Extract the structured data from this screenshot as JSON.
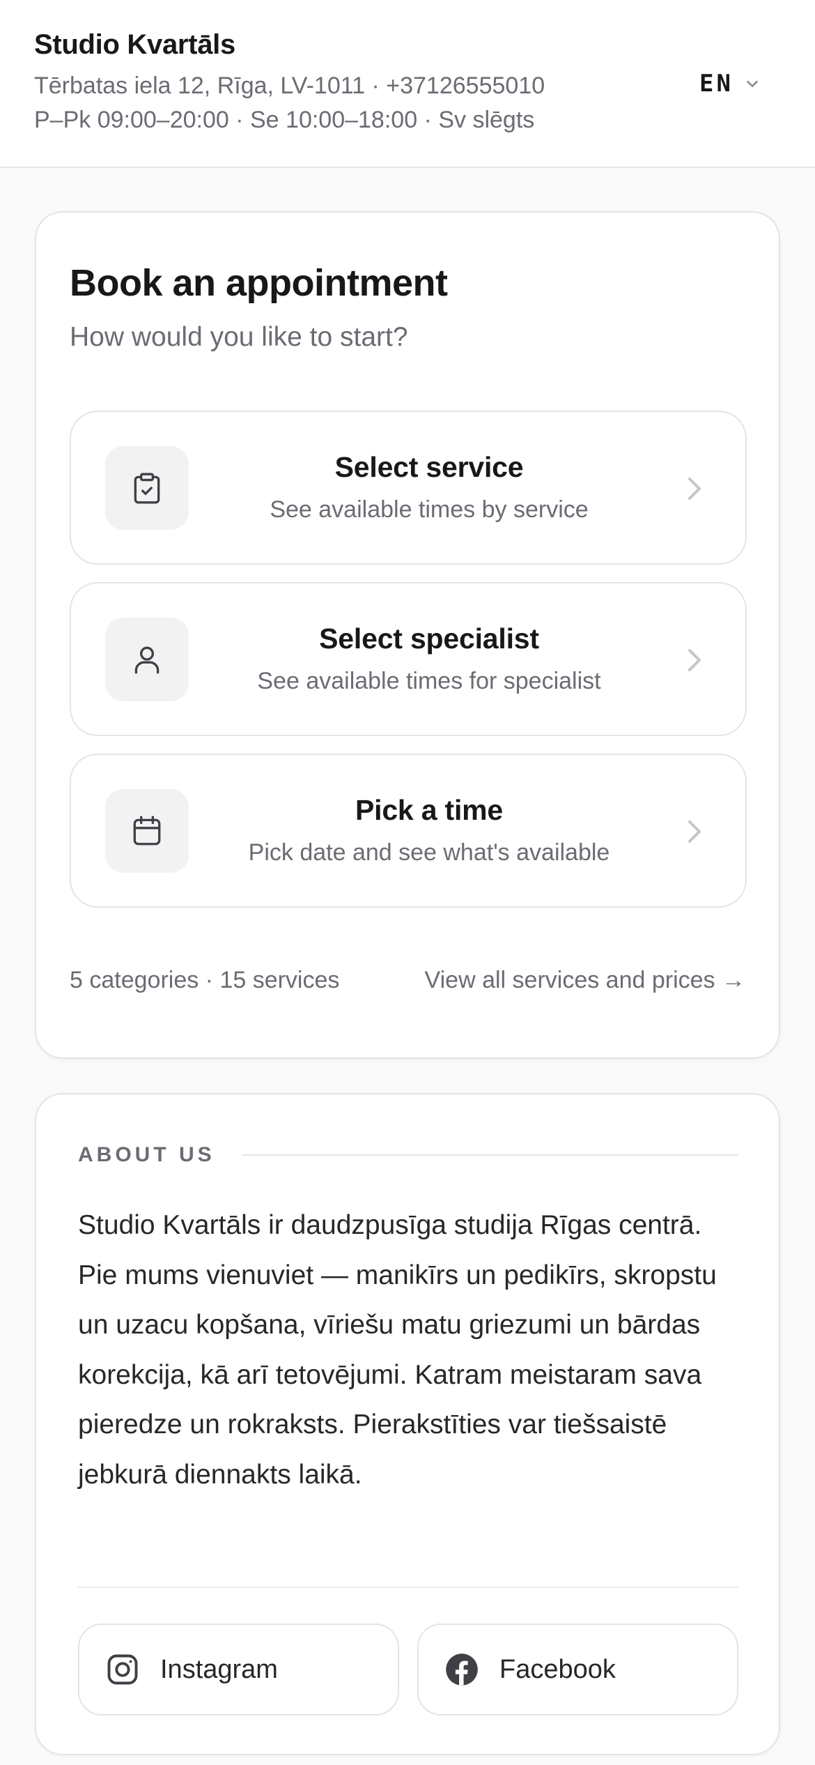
{
  "header": {
    "business_name": "Studio Kvartāls",
    "address_line": "Tērbatas iela 12, Rīga, LV-1011 · +37126555010",
    "hours_line": "P–Pk 09:00–20:00 · Se 10:00–18:00 · Sv slēgts",
    "language": "EN",
    "language_icon": "chevron-down-icon"
  },
  "booking": {
    "title": "Book an appointment",
    "subtitle": "How would you like to start?",
    "options": [
      {
        "title": "Select service",
        "description": "See available times by service",
        "icon": "clipboard-check-icon"
      },
      {
        "title": "Select specialist",
        "description": "See available times for specialist",
        "icon": "user-icon"
      },
      {
        "title": "Pick a time",
        "description": "Pick date and see what's available",
        "icon": "calendar-icon"
      }
    ],
    "summary": "5 categories · 15 services",
    "view_all": "View all services and prices →"
  },
  "about": {
    "label": "ABOUT US",
    "text": "Studio Kvartāls ir daudzpusīga studija Rīgas centrā. Pie mums vienuviet — manikīrs un pedikīrs, skropstu un uzacu kopšana, vīriešu matu griezumi un bārdas korekcija, kā arī tetovējumi. Katram meistaram sava pieredze un rokraksts. Pierakstīties var tiešsaistē jebkurā diennakts laikā.",
    "social": [
      {
        "label": "Instagram",
        "icon": "instagram-icon"
      },
      {
        "label": "Facebook",
        "icon": "facebook-icon"
      }
    ]
  },
  "colors": {
    "page_background": "#fafafa",
    "card_background": "#ffffff",
    "text_primary": "#18181b",
    "text_muted": "#6b6b73",
    "border": "#e4e4e7",
    "icon_tile": "#f2f2f3"
  }
}
